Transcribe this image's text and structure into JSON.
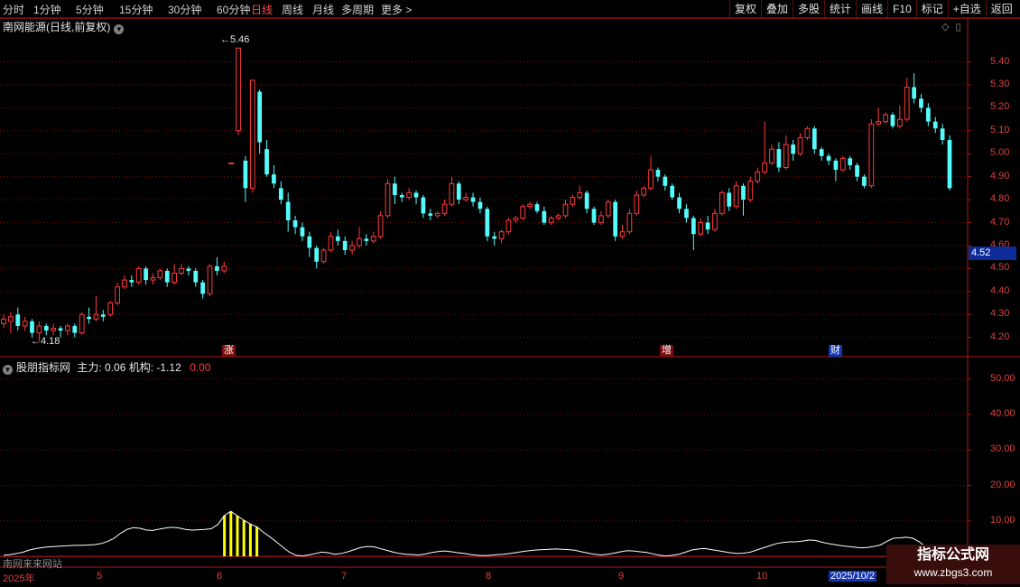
{
  "toolbar": {
    "periods": [
      "分时",
      "1分钟",
      "5分钟",
      "15分钟",
      "30分钟",
      "60分钟",
      "日线",
      "周线",
      "月线",
      "多周期",
      "更多 >"
    ],
    "active_period": "日线",
    "right_buttons": [
      "复权",
      "叠加",
      "多股",
      "统计",
      "画线",
      "F10",
      "标记",
      "+自选",
      "返回"
    ]
  },
  "main_title": "南网能源(日线,前复权)",
  "sub_title": {
    "name": "股朋指标网",
    "values_text": "主力: 0.06  机构: -1.12",
    "zero_text": "0.00"
  },
  "current_price": "4.52",
  "max_label": "5.46",
  "min_label": "4.18",
  "event_tags": [
    {
      "text": "涨",
      "color": "red"
    },
    {
      "text": "增",
      "color": "red"
    },
    {
      "text": "财",
      "color": "blue"
    }
  ],
  "source_text": "南网来来网站",
  "watermark": {
    "line1": "指标公式网",
    "line2": "www.zbgs3.com"
  },
  "colors": {
    "up": "#ff3b3b",
    "down": "#54fcfc",
    "grid": "#7a1010",
    "axis": "#b01818",
    "bar": "#ffff00",
    "line": "#ffffff"
  },
  "chart_data": [
    {
      "type": "candlestick",
      "title": "南网能源(日线,前复权)",
      "y_ticks": [
        "5.40",
        "5.30",
        "5.20",
        "5.10",
        "5.00",
        "4.90",
        "4.80",
        "4.70",
        "4.60",
        "4.50",
        "4.40",
        "4.30",
        "4.20"
      ],
      "ylim": [
        4.12,
        5.52
      ],
      "x_ticks": [
        "2025年",
        "5",
        "6",
        "7",
        "8",
        "9",
        "10",
        "2025/10/2"
      ],
      "candles": [
        [
          4.26,
          4.28,
          4.24,
          4.3
        ],
        [
          4.27,
          4.29,
          4.22,
          4.31
        ],
        [
          4.3,
          4.25,
          4.23,
          4.33
        ],
        [
          4.25,
          4.27,
          4.23,
          4.29
        ],
        [
          4.27,
          4.22,
          4.2,
          4.28
        ],
        [
          4.22,
          4.25,
          4.18,
          4.27
        ],
        [
          4.25,
          4.23,
          4.21,
          4.26
        ],
        [
          4.23,
          4.24,
          4.21,
          4.26
        ],
        [
          4.24,
          4.23,
          4.2,
          4.25
        ],
        [
          4.23,
          4.25,
          4.21,
          4.26
        ],
        [
          4.25,
          4.22,
          4.2,
          4.26
        ],
        [
          4.22,
          4.3,
          4.21,
          4.31
        ],
        [
          4.29,
          4.28,
          4.26,
          4.33
        ],
        [
          4.28,
          4.3,
          4.27,
          4.38
        ],
        [
          4.3,
          4.29,
          4.27,
          4.32
        ],
        [
          4.3,
          4.35,
          4.29,
          4.36
        ],
        [
          4.35,
          4.42,
          4.34,
          4.44
        ],
        [
          4.42,
          4.45,
          4.41,
          4.47
        ],
        [
          4.45,
          4.44,
          4.42,
          4.47
        ],
        [
          4.44,
          4.5,
          4.43,
          4.51
        ],
        [
          4.5,
          4.45,
          4.43,
          4.51
        ],
        [
          4.45,
          4.46,
          4.43,
          4.48
        ],
        [
          4.46,
          4.49,
          4.45,
          4.5
        ],
        [
          4.49,
          4.44,
          4.42,
          4.5
        ],
        [
          4.44,
          4.48,
          4.43,
          4.52
        ],
        [
          4.48,
          4.5,
          4.47,
          4.52
        ],
        [
          4.5,
          4.49,
          4.47,
          4.51
        ],
        [
          4.49,
          4.44,
          4.42,
          4.5
        ],
        [
          4.44,
          4.39,
          4.37,
          4.45
        ],
        [
          4.39,
          4.51,
          4.38,
          4.52
        ],
        [
          4.51,
          4.49,
          4.47,
          4.55
        ],
        [
          4.49,
          4.51,
          4.48,
          4.53
        ],
        [
          4.96,
          4.96,
          4.96,
          4.96
        ],
        [
          5.1,
          5.46,
          5.08,
          5.46
        ],
        [
          4.97,
          4.85,
          4.79,
          4.99
        ],
        [
          4.85,
          5.32,
          4.83,
          5.32
        ],
        [
          5.27,
          5.05,
          5.0,
          5.28
        ],
        [
          5.02,
          4.91,
          4.9,
          5.06
        ],
        [
          4.91,
          4.87,
          4.85,
          4.95
        ],
        [
          4.85,
          4.8,
          4.78,
          4.88
        ],
        [
          4.79,
          4.71,
          4.66,
          4.83
        ],
        [
          4.71,
          4.68,
          4.65,
          4.73
        ],
        [
          4.68,
          4.64,
          4.62,
          4.7
        ],
        [
          4.64,
          4.59,
          4.55,
          4.66
        ],
        [
          4.59,
          4.53,
          4.5,
          4.6
        ],
        [
          4.53,
          4.58,
          4.52,
          4.59
        ],
        [
          4.58,
          4.64,
          4.57,
          4.66
        ],
        [
          4.64,
          4.62,
          4.6,
          4.67
        ],
        [
          4.62,
          4.58,
          4.56,
          4.64
        ],
        [
          4.58,
          4.6,
          4.56,
          4.62
        ],
        [
          4.6,
          4.63,
          4.59,
          4.68
        ],
        [
          4.63,
          4.62,
          4.6,
          4.65
        ],
        [
          4.62,
          4.64,
          4.61,
          4.66
        ],
        [
          4.64,
          4.73,
          4.63,
          4.75
        ],
        [
          4.73,
          4.87,
          4.72,
          4.89
        ],
        [
          4.87,
          4.82,
          4.78,
          4.9
        ],
        [
          4.82,
          4.81,
          4.79,
          4.83
        ],
        [
          4.81,
          4.83,
          4.8,
          4.85
        ],
        [
          4.83,
          4.81,
          4.78,
          4.84
        ],
        [
          4.81,
          4.74,
          4.72,
          4.82
        ],
        [
          4.74,
          4.73,
          4.71,
          4.76
        ],
        [
          4.73,
          4.74,
          4.72,
          4.75
        ],
        [
          4.74,
          4.78,
          4.73,
          4.8
        ],
        [
          4.78,
          4.87,
          4.77,
          4.9
        ],
        [
          4.87,
          4.8,
          4.78,
          4.88
        ],
        [
          4.8,
          4.81,
          4.79,
          4.83
        ],
        [
          4.81,
          4.79,
          4.77,
          4.83
        ],
        [
          4.79,
          4.76,
          4.74,
          4.81
        ],
        [
          4.76,
          4.64,
          4.62,
          4.77
        ],
        [
          4.64,
          4.63,
          4.6,
          4.66
        ],
        [
          4.63,
          4.66,
          4.61,
          4.67
        ],
        [
          4.66,
          4.71,
          4.65,
          4.72
        ],
        [
          4.71,
          4.72,
          4.7,
          4.73
        ],
        [
          4.72,
          4.77,
          4.71,
          4.78
        ],
        [
          4.77,
          4.78,
          4.76,
          4.79
        ],
        [
          4.78,
          4.75,
          4.74,
          4.79
        ],
        [
          4.75,
          4.7,
          4.69,
          4.77
        ],
        [
          4.7,
          4.72,
          4.69,
          4.73
        ],
        [
          4.72,
          4.73,
          4.71,
          4.74
        ],
        [
          4.73,
          4.78,
          4.72,
          4.8
        ],
        [
          4.78,
          4.81,
          4.77,
          4.82
        ],
        [
          4.81,
          4.83,
          4.8,
          4.86
        ],
        [
          4.83,
          4.76,
          4.74,
          4.84
        ],
        [
          4.76,
          4.7,
          4.69,
          4.77
        ],
        [
          4.7,
          4.73,
          4.69,
          4.75
        ],
        [
          4.73,
          4.79,
          4.72,
          4.8
        ],
        [
          4.79,
          4.64,
          4.62,
          4.8
        ],
        [
          4.64,
          4.66,
          4.63,
          4.69
        ],
        [
          4.66,
          4.74,
          4.65,
          4.76
        ],
        [
          4.74,
          4.82,
          4.73,
          4.84
        ],
        [
          4.82,
          4.85,
          4.81,
          4.86
        ],
        [
          4.85,
          4.93,
          4.84,
          4.99
        ],
        [
          4.93,
          4.9,
          4.88,
          4.94
        ],
        [
          4.9,
          4.86,
          4.84,
          4.91
        ],
        [
          4.86,
          4.81,
          4.8,
          4.87
        ],
        [
          4.81,
          4.76,
          4.74,
          4.83
        ],
        [
          4.76,
          4.72,
          4.7,
          4.78
        ],
        [
          4.72,
          4.65,
          4.58,
          4.73
        ],
        [
          4.65,
          4.7,
          4.64,
          4.72
        ],
        [
          4.7,
          4.67,
          4.65,
          4.73
        ],
        [
          4.67,
          4.74,
          4.66,
          4.76
        ],
        [
          4.74,
          4.83,
          4.73,
          4.84
        ],
        [
          4.83,
          4.77,
          4.75,
          4.85
        ],
        [
          4.77,
          4.86,
          4.76,
          4.88
        ],
        [
          4.86,
          4.8,
          4.73,
          4.87
        ],
        [
          4.8,
          4.88,
          4.79,
          4.9
        ],
        [
          4.88,
          4.92,
          4.87,
          4.94
        ],
        [
          4.92,
          4.96,
          4.91,
          5.14
        ],
        [
          4.96,
          5.02,
          4.95,
          5.04
        ],
        [
          5.02,
          4.94,
          4.92,
          5.05
        ],
        [
          4.94,
          5.04,
          4.93,
          5.08
        ],
        [
          5.04,
          5.0,
          4.97,
          5.06
        ],
        [
          5.0,
          5.07,
          4.99,
          5.09
        ],
        [
          5.07,
          5.11,
          5.06,
          5.12
        ],
        [
          5.11,
          5.02,
          5.0,
          5.12
        ],
        [
          5.02,
          4.99,
          4.97,
          5.03
        ],
        [
          4.99,
          4.97,
          4.95,
          5.0
        ],
        [
          4.97,
          4.93,
          4.88,
          4.98
        ],
        [
          4.93,
          4.98,
          4.92,
          4.99
        ],
        [
          4.98,
          4.95,
          4.93,
          4.99
        ],
        [
          4.95,
          4.9,
          4.88,
          4.96
        ],
        [
          4.9,
          4.86,
          4.85,
          4.91
        ],
        [
          4.86,
          5.13,
          4.85,
          5.15
        ],
        [
          5.13,
          5.14,
          5.12,
          5.2
        ],
        [
          5.14,
          5.17,
          5.13,
          5.18
        ],
        [
          5.17,
          5.12,
          5.11,
          5.18
        ],
        [
          5.12,
          5.15,
          5.11,
          5.21
        ],
        [
          5.15,
          5.29,
          5.14,
          5.33
        ],
        [
          5.29,
          5.24,
          5.22,
          5.35
        ],
        [
          5.24,
          5.2,
          5.18,
          5.26
        ],
        [
          5.2,
          5.14,
          5.12,
          5.22
        ],
        [
          5.14,
          5.11,
          5.09,
          5.16
        ],
        [
          5.11,
          5.06,
          5.04,
          5.13
        ],
        [
          5.06,
          4.85,
          4.84,
          5.08
        ]
      ]
    },
    {
      "type": "bar+line",
      "title": "股朋指标网",
      "y_ticks": [
        "50.00",
        "40.00",
        "30.00",
        "20.00",
        "10.00"
      ],
      "ylim": [
        -1,
        55
      ],
      "line": [
        0.3,
        0.5,
        0.8,
        1.2,
        1.8,
        2.2,
        2.5,
        2.7,
        2.8,
        2.9,
        3.0,
        3.1,
        3.1,
        3.2,
        3.3,
        3.6,
        4.2,
        5.1,
        6.5,
        7.6,
        8.1,
        7.9,
        7.4,
        7.3,
        7.7,
        8.0,
        8.2,
        8.0,
        7.6,
        7.4,
        7.5,
        7.6,
        7.8,
        9.0,
        11.5,
        12.7,
        11.4,
        10.2,
        9.1,
        8.3,
        6.8,
        5.5,
        4.1,
        2.6,
        1.2,
        0.3,
        0.1,
        0.4,
        0.8,
        1.2,
        1.0,
        0.6,
        0.8,
        1.3,
        1.9,
        2.5,
        2.8,
        2.7,
        2.2,
        1.7,
        1.2,
        0.8,
        0.6,
        0.5,
        0.4,
        0.7,
        1.1,
        1.4,
        1.5,
        1.3,
        1.0,
        0.8,
        0.5,
        0.3,
        0.2,
        0.3,
        0.5,
        0.6,
        0.8,
        1.1,
        1.4,
        1.6,
        1.8,
        1.9,
        2.0,
        2.1,
        2.0,
        1.9,
        1.7,
        1.3,
        0.9,
        0.6,
        0.4,
        0.6,
        0.9,
        1.3,
        1.6,
        1.5,
        1.3,
        1.1,
        0.7,
        0.3,
        0.1,
        0.3,
        0.6,
        1.2,
        1.8,
        2.1,
        2.2,
        1.9,
        1.6,
        1.3,
        1.0,
        0.8,
        0.9,
        1.2,
        1.8,
        2.4,
        3.0,
        3.6,
        3.9,
        4.1,
        4.1,
        4.3,
        4.6,
        4.5,
        4.0,
        3.6,
        3.3,
        3.0,
        2.8,
        2.6,
        2.4,
        2.5,
        2.8,
        3.2,
        4.2,
        5.1,
        5.2,
        5.4,
        5.1,
        4.1,
        2.7,
        1.2,
        0.3
      ],
      "bars": [
        0,
        0,
        0,
        0,
        0,
        0,
        0,
        0,
        0,
        0,
        0,
        0,
        0,
        0,
        0,
        0,
        0,
        0,
        0,
        0,
        0,
        0,
        0,
        0,
        0,
        0,
        0,
        0,
        0,
        0,
        0,
        0,
        0,
        0,
        11.5,
        12.7,
        11.4,
        10.2,
        9.1,
        8.3,
        0,
        0,
        0,
        0,
        0,
        0,
        0,
        0,
        0,
        0,
        0,
        0,
        0,
        0,
        0,
        0,
        0,
        0,
        0,
        0,
        0,
        0,
        0,
        0,
        0,
        0,
        0,
        0,
        0,
        0,
        0,
        0,
        0,
        0,
        0,
        0,
        0,
        0,
        0,
        0,
        0,
        0,
        0,
        0,
        0,
        0,
        0,
        0,
        0,
        0,
        0,
        0,
        0,
        0,
        0,
        0,
        0,
        0,
        0,
        0,
        0,
        0,
        0,
        0,
        0,
        0,
        0,
        0,
        0,
        0,
        0,
        0,
        0,
        0,
        0,
        0,
        0,
        0,
        0,
        0,
        0,
        0,
        0,
        0,
        0,
        0,
        0,
        0,
        0,
        0,
        0,
        0,
        0,
        0,
        0,
        0,
        0,
        0,
        0,
        0,
        0,
        0,
        0,
        0,
        0,
        0,
        0
      ]
    }
  ]
}
